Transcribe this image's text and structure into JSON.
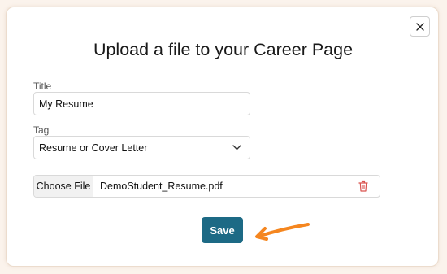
{
  "dialog": {
    "title": "Upload a file to your Career Page",
    "close_icon": "close-icon"
  },
  "form": {
    "title_label": "Title",
    "title_value": "My Resume",
    "tag_label": "Tag",
    "tag_value": "Resume or Cover Letter",
    "tag_icon": "chevron-down-icon",
    "choose_file_label": "Choose File",
    "file_name": "DemoStudent_Resume.pdf",
    "delete_icon": "trash-icon",
    "save_label": "Save"
  },
  "annotation": {
    "icon": "arrow-left-icon",
    "color": "#f5861f"
  },
  "colors": {
    "primary": "#1d6a85",
    "danger": "#d9534f",
    "background": "#fbf3ec"
  }
}
